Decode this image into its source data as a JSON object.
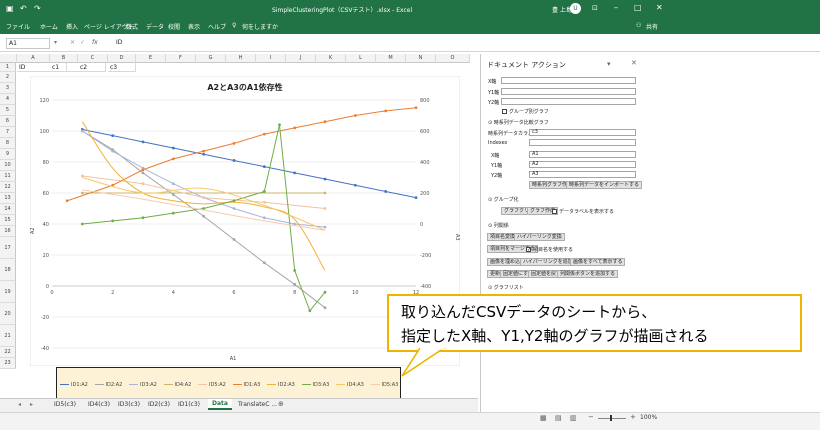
{
  "window": {
    "title": "SimpleClusteringPlot（CSVテスト）.xlsx  -  Excel",
    "user": "豊 上島",
    "share_label": "共有",
    "avatar_label": "U",
    "search_label": "何をしますか",
    "qat_icons": [
      "save-icon",
      "undo-icon",
      "redo-icon"
    ],
    "controls": [
      "minimize-icon",
      "maximize-icon",
      "close-icon"
    ]
  },
  "ribbon": {
    "tabs": [
      "ファイル",
      "ホーム",
      "挿入",
      "ページ レイアウト",
      "数式",
      "データ",
      "校閲",
      "表示",
      "ヘルプ"
    ]
  },
  "formula": {
    "name_box": "A1",
    "value": "ID",
    "fx": "fx"
  },
  "grid": {
    "columns": [
      "A",
      "B",
      "C",
      "D",
      "E",
      "F",
      "G",
      "H",
      "I",
      "J",
      "K",
      "L",
      "M",
      "N",
      "O"
    ],
    "rows": [
      "1",
      "2",
      "3",
      "4",
      "5",
      "6",
      "7",
      "8",
      "9",
      "10",
      "11",
      "12",
      "13",
      "14",
      "15",
      "16",
      "17",
      "18",
      "19",
      "20",
      "21",
      "22",
      "23"
    ],
    "row1": [
      "ID",
      "c1",
      "c2",
      "c3"
    ]
  },
  "chart_data": {
    "type": "line",
    "title": "A2とA3のA1依存性",
    "xlabel": "A1",
    "ylabel_left": "A2",
    "ylabel_right": "A3",
    "xlim": [
      0,
      12
    ],
    "ylim_left": [
      -40,
      120
    ],
    "ylim_right": [
      -800,
      800
    ],
    "x_ticks": [
      "0",
      "2",
      "4",
      "6",
      "8",
      "10",
      "12"
    ],
    "y_left_ticks": [
      "120",
      "100",
      "80",
      "60",
      "40",
      "20",
      "0",
      "-20",
      "-40"
    ],
    "y_right_ticks": [
      "800",
      "600",
      "400",
      "200",
      "0",
      "-200",
      "-400",
      "-600",
      "-800"
    ],
    "legend_position": "bottom",
    "series": [
      {
        "name": "ID1:A2",
        "axis": "left",
        "color": "#4472c4",
        "style": "markers",
        "x": [
          1,
          2,
          3,
          4,
          5,
          6,
          7,
          8,
          9,
          10,
          11,
          12
        ],
        "y": [
          101,
          97,
          93,
          89,
          85,
          81,
          77,
          73,
          69,
          65,
          61,
          57
        ]
      },
      {
        "name": "ID2:A2",
        "axis": "left",
        "color": "#a5a5a5",
        "style": "markers",
        "x": [
          1,
          2,
          3,
          4,
          5,
          6,
          7,
          8,
          9
        ],
        "y": [
          100,
          88,
          73,
          59,
          45,
          30,
          15,
          1,
          -14
        ]
      },
      {
        "name": "ID3:A2",
        "axis": "left",
        "color": "#a9b6d8",
        "style": "markers",
        "x": [
          1,
          2,
          3,
          4,
          5,
          6,
          7,
          8,
          9
        ],
        "y": [
          100,
          87,
          76,
          66,
          57,
          50,
          44,
          40,
          38
        ]
      },
      {
        "name": "ID4:A2",
        "axis": "left",
        "color": "#c9b76b",
        "style": "markers",
        "x": [
          1,
          9
        ],
        "y": [
          60,
          60
        ]
      },
      {
        "name": "ID5:A2",
        "axis": "left",
        "color": "#f4c2a4",
        "style": "markers",
        "x": [
          1,
          3,
          5,
          7,
          9
        ],
        "y": [
          71,
          66,
          57,
          54,
          50
        ]
      },
      {
        "name": "ID1:A3",
        "axis": "right",
        "color": "#ed7d31",
        "style": "markers",
        "x": [
          0.5,
          2,
          3,
          4,
          5,
          6,
          7,
          8,
          9,
          10,
          11,
          12
        ],
        "y": [
          150,
          250,
          350,
          420,
          470,
          520,
          580,
          620,
          660,
          700,
          730,
          750
        ]
      },
      {
        "name": "ID2:A3",
        "axis": "right",
        "color": "#f2b134",
        "style": "smooth",
        "x": [
          1,
          2,
          3,
          4,
          5,
          6,
          7,
          8,
          9
        ],
        "y": [
          660,
          360,
          200,
          150,
          130,
          140,
          110,
          30,
          -300
        ]
      },
      {
        "name": "ID3:A3",
        "axis": "right",
        "color": "#70ad47",
        "style": "markers",
        "x": [
          1,
          2,
          3,
          4,
          5,
          6,
          7,
          7.5,
          8,
          8.5,
          9
        ],
        "y": [
          0,
          20,
          40,
          70,
          100,
          150,
          210,
          640,
          -300,
          -560,
          -440
        ]
      },
      {
        "name": "ID4:A3",
        "axis": "right",
        "color": "#f7c86b",
        "style": "smooth",
        "x": [
          1,
          3,
          5,
          7,
          9
        ],
        "y": [
          300,
          200,
          230,
          120,
          -40
        ]
      },
      {
        "name": "ID5:A3",
        "axis": "right",
        "color": "#f8cbad",
        "style": "smooth",
        "x": [
          1,
          3,
          5,
          7,
          9
        ],
        "y": [
          220,
          160,
          90,
          20,
          -40
        ]
      }
    ]
  },
  "sheets": {
    "tabs": [
      "ID5(c3)",
      "ID4(c3)",
      "ID3(c3)",
      "ID2(c3)",
      "ID1(c3)",
      "Data",
      "TranslateC ..."
    ],
    "active": "Data"
  },
  "status": {
    "zoom": "100%"
  },
  "pane": {
    "title": "ドキュメント アクション",
    "x_axis_label": "X軸",
    "y1_axis_label": "Y1軸",
    "y2_axis_label": "Y2軸",
    "group_chart_label": "グループ別グラフ",
    "series_section": "時系列データ比較グラフ",
    "series_column_label": "時系列データカラム",
    "series_column_value": "c3",
    "indexes_label": "Indexes",
    "x2_label": "X軸",
    "x2_value": "A1",
    "y1b_label": "Y1軸",
    "y1b_value": "A2",
    "y2b_label": "Y2軸",
    "y2b_value": "A3",
    "btn_make_series": "時系列グラフ作成",
    "btn_import_series": "時系列データをインポートする",
    "grouping_section": "グループ化",
    "btn_group_clear": "グラフクリア",
    "btn_group_make": "グラフ作成",
    "data_label_chk": "データラベルを表示する",
    "column_ops_section": "列関係",
    "btn_rename": "項目名変換",
    "btn_hyperlink": "ハイパーリンク変換",
    "btn_merge_cols": "項目列をマージする",
    "chk_use_name": "項目名を使用する",
    "btn_image_insert": "画像を埋め込む",
    "btn_add_hyperlink": "ハイパーリンクを追加する",
    "btn_image_all": "画像をすべて表示する",
    "btn_update": "更新",
    "btn_fix_value": "固定値にする",
    "btn_restore": "固定値を戻す",
    "btn_add_button": "列関係ボタンを追加する",
    "graph_list_section": "グラフリスト"
  },
  "callout": {
    "line1": "取り込んだCSVデータのシートから、",
    "line2": "指定したX軸、Y1,Y2軸のグラフが描画される"
  }
}
